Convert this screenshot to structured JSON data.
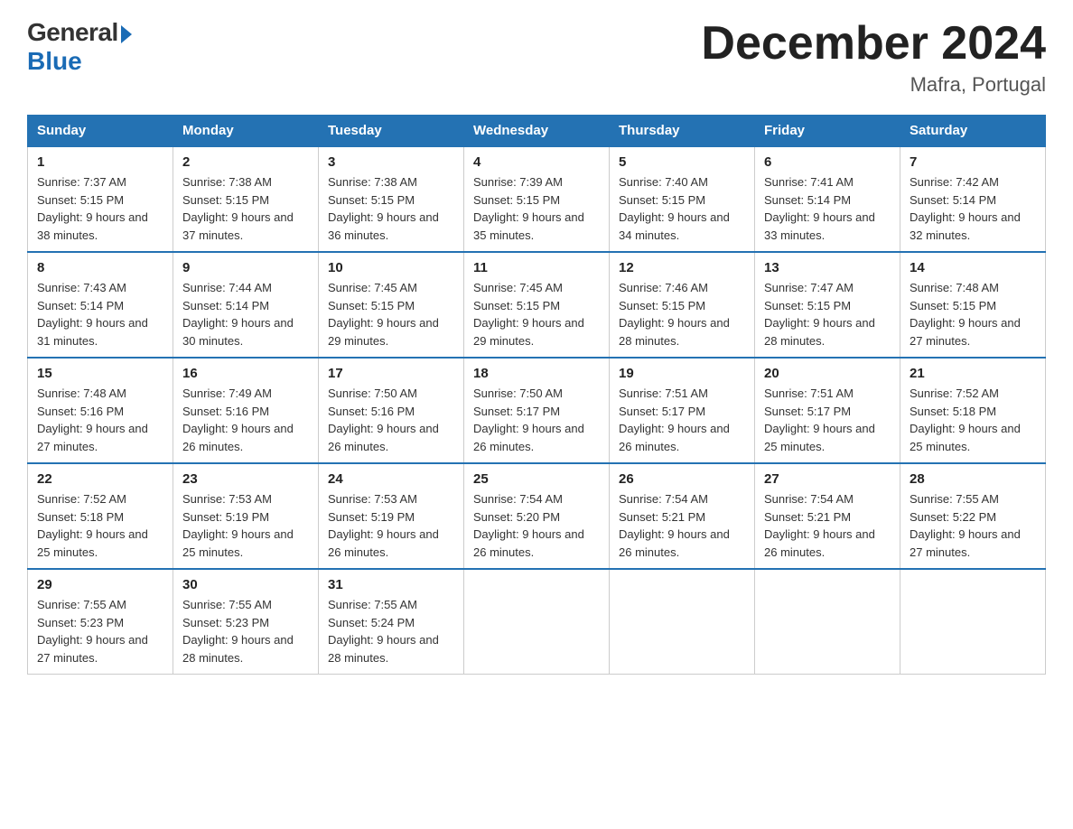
{
  "header": {
    "logo_general": "General",
    "logo_blue": "Blue",
    "main_title": "December 2024",
    "subtitle": "Mafra, Portugal"
  },
  "columns": [
    "Sunday",
    "Monday",
    "Tuesday",
    "Wednesday",
    "Thursday",
    "Friday",
    "Saturday"
  ],
  "weeks": [
    [
      {
        "day": "1",
        "sunrise": "7:37 AM",
        "sunset": "5:15 PM",
        "daylight": "9 hours and 38 minutes."
      },
      {
        "day": "2",
        "sunrise": "7:38 AM",
        "sunset": "5:15 PM",
        "daylight": "9 hours and 37 minutes."
      },
      {
        "day": "3",
        "sunrise": "7:38 AM",
        "sunset": "5:15 PM",
        "daylight": "9 hours and 36 minutes."
      },
      {
        "day": "4",
        "sunrise": "7:39 AM",
        "sunset": "5:15 PM",
        "daylight": "9 hours and 35 minutes."
      },
      {
        "day": "5",
        "sunrise": "7:40 AM",
        "sunset": "5:15 PM",
        "daylight": "9 hours and 34 minutes."
      },
      {
        "day": "6",
        "sunrise": "7:41 AM",
        "sunset": "5:14 PM",
        "daylight": "9 hours and 33 minutes."
      },
      {
        "day": "7",
        "sunrise": "7:42 AM",
        "sunset": "5:14 PM",
        "daylight": "9 hours and 32 minutes."
      }
    ],
    [
      {
        "day": "8",
        "sunrise": "7:43 AM",
        "sunset": "5:14 PM",
        "daylight": "9 hours and 31 minutes."
      },
      {
        "day": "9",
        "sunrise": "7:44 AM",
        "sunset": "5:14 PM",
        "daylight": "9 hours and 30 minutes."
      },
      {
        "day": "10",
        "sunrise": "7:45 AM",
        "sunset": "5:15 PM",
        "daylight": "9 hours and 29 minutes."
      },
      {
        "day": "11",
        "sunrise": "7:45 AM",
        "sunset": "5:15 PM",
        "daylight": "9 hours and 29 minutes."
      },
      {
        "day": "12",
        "sunrise": "7:46 AM",
        "sunset": "5:15 PM",
        "daylight": "9 hours and 28 minutes."
      },
      {
        "day": "13",
        "sunrise": "7:47 AM",
        "sunset": "5:15 PM",
        "daylight": "9 hours and 28 minutes."
      },
      {
        "day": "14",
        "sunrise": "7:48 AM",
        "sunset": "5:15 PM",
        "daylight": "9 hours and 27 minutes."
      }
    ],
    [
      {
        "day": "15",
        "sunrise": "7:48 AM",
        "sunset": "5:16 PM",
        "daylight": "9 hours and 27 minutes."
      },
      {
        "day": "16",
        "sunrise": "7:49 AM",
        "sunset": "5:16 PM",
        "daylight": "9 hours and 26 minutes."
      },
      {
        "day": "17",
        "sunrise": "7:50 AM",
        "sunset": "5:16 PM",
        "daylight": "9 hours and 26 minutes."
      },
      {
        "day": "18",
        "sunrise": "7:50 AM",
        "sunset": "5:17 PM",
        "daylight": "9 hours and 26 minutes."
      },
      {
        "day": "19",
        "sunrise": "7:51 AM",
        "sunset": "5:17 PM",
        "daylight": "9 hours and 26 minutes."
      },
      {
        "day": "20",
        "sunrise": "7:51 AM",
        "sunset": "5:17 PM",
        "daylight": "9 hours and 25 minutes."
      },
      {
        "day": "21",
        "sunrise": "7:52 AM",
        "sunset": "5:18 PM",
        "daylight": "9 hours and 25 minutes."
      }
    ],
    [
      {
        "day": "22",
        "sunrise": "7:52 AM",
        "sunset": "5:18 PM",
        "daylight": "9 hours and 25 minutes."
      },
      {
        "day": "23",
        "sunrise": "7:53 AM",
        "sunset": "5:19 PM",
        "daylight": "9 hours and 25 minutes."
      },
      {
        "day": "24",
        "sunrise": "7:53 AM",
        "sunset": "5:19 PM",
        "daylight": "9 hours and 26 minutes."
      },
      {
        "day": "25",
        "sunrise": "7:54 AM",
        "sunset": "5:20 PM",
        "daylight": "9 hours and 26 minutes."
      },
      {
        "day": "26",
        "sunrise": "7:54 AM",
        "sunset": "5:21 PM",
        "daylight": "9 hours and 26 minutes."
      },
      {
        "day": "27",
        "sunrise": "7:54 AM",
        "sunset": "5:21 PM",
        "daylight": "9 hours and 26 minutes."
      },
      {
        "day": "28",
        "sunrise": "7:55 AM",
        "sunset": "5:22 PM",
        "daylight": "9 hours and 27 minutes."
      }
    ],
    [
      {
        "day": "29",
        "sunrise": "7:55 AM",
        "sunset": "5:23 PM",
        "daylight": "9 hours and 27 minutes."
      },
      {
        "day": "30",
        "sunrise": "7:55 AM",
        "sunset": "5:23 PM",
        "daylight": "9 hours and 28 minutes."
      },
      {
        "day": "31",
        "sunrise": "7:55 AM",
        "sunset": "5:24 PM",
        "daylight": "9 hours and 28 minutes."
      },
      null,
      null,
      null,
      null
    ]
  ]
}
